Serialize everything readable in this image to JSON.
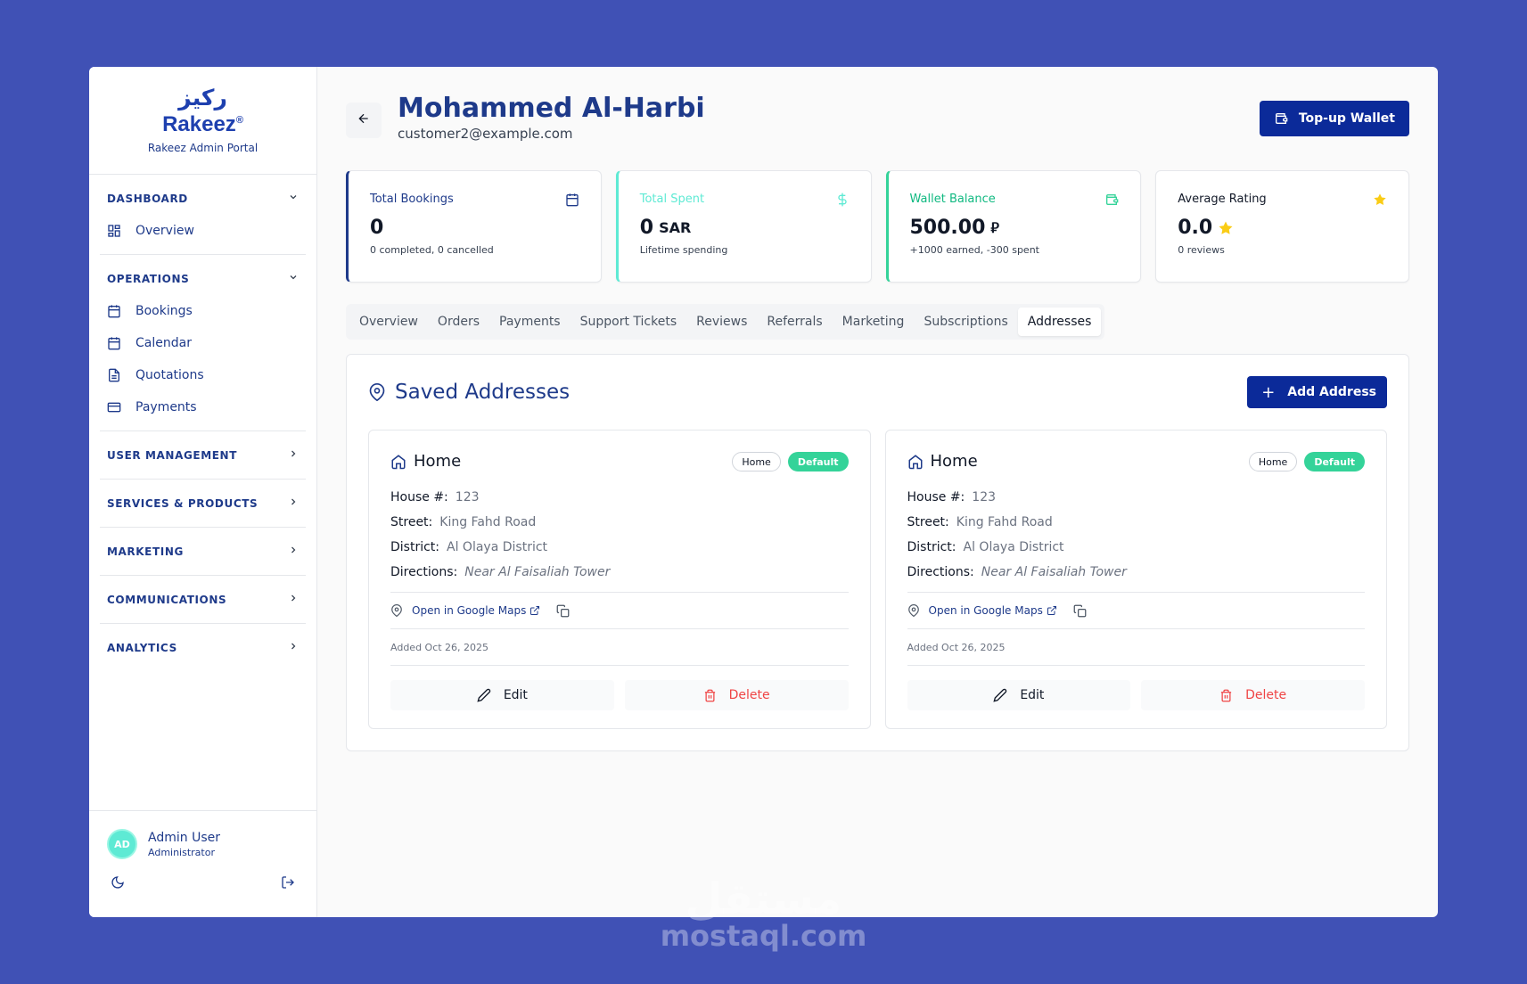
{
  "brand": {
    "arabic": "ركيز",
    "name": "Rakeez",
    "registered": "®",
    "subtitle": "Rakeez Admin Portal"
  },
  "sidebar": {
    "sections": [
      {
        "label": "DASHBOARD",
        "items": [
          "Overview"
        ]
      },
      {
        "label": "OPERATIONS",
        "items": [
          "Bookings",
          "Calendar",
          "Quotations",
          "Payments"
        ]
      },
      {
        "label": "USER MANAGEMENT"
      },
      {
        "label": "SERVICES & PRODUCTS"
      },
      {
        "label": "MARKETING"
      },
      {
        "label": "COMMUNICATIONS"
      },
      {
        "label": "ANALYTICS"
      }
    ],
    "user": {
      "initials": "AD",
      "name": "Admin User",
      "role": "Administrator"
    }
  },
  "header": {
    "title": "Mohammed Al-Harbi",
    "email": "customer2@example.com",
    "topup_label": "Top-up Wallet"
  },
  "stats": [
    {
      "label": "Total Bookings",
      "value": "0",
      "sub": "0 completed, 0 cancelled"
    },
    {
      "label": "Total Spent",
      "value": "0",
      "unit": "SAR",
      "sub": "Lifetime spending"
    },
    {
      "label": "Wallet Balance",
      "value": "500.00",
      "unit": "⃁",
      "sub": "+1000 earned, -300 spent"
    },
    {
      "label": "Average Rating",
      "value": "0.0",
      "sub": "0 reviews"
    }
  ],
  "tabs": [
    "Overview",
    "Orders",
    "Payments",
    "Support Tickets",
    "Reviews",
    "Referrals",
    "Marketing",
    "Subscriptions",
    "Addresses"
  ],
  "active_tab": "Addresses",
  "addresses": {
    "title": "Saved Addresses",
    "add_label": "Add Address",
    "cards": [
      {
        "name": "Home",
        "type_badge": "Home",
        "default_badge": "Default",
        "house_label": "House #:",
        "house": "123",
        "street_label": "Street:",
        "street": "King Fahd Road",
        "district_label": "District:",
        "district": "Al Olaya District",
        "directions_label": "Directions:",
        "directions": "Near Al Faisaliah Tower",
        "maps_label": "Open in Google Maps",
        "added": "Added Oct 26, 2025",
        "edit_label": "Edit",
        "delete_label": "Delete"
      },
      {
        "name": "Home",
        "type_badge": "Home",
        "default_badge": "Default",
        "house_label": "House #:",
        "house": "123",
        "street_label": "Street:",
        "street": "King Fahd Road",
        "district_label": "District:",
        "district": "Al Olaya District",
        "directions_label": "Directions:",
        "directions": "Near Al Faisaliah Tower",
        "maps_label": "Open in Google Maps",
        "added": "Added Oct 26, 2025",
        "edit_label": "Edit",
        "delete_label": "Delete"
      }
    ]
  },
  "watermark": {
    "arabic": "مستقل",
    "latin": "mostaql.com"
  },
  "colors": {
    "background": "#4051b5",
    "primary": "#0b2a99",
    "navy_text": "#1e3a8a",
    "teal": "#5eead4",
    "green": "#34d399",
    "danger": "#ef4444",
    "star": "#facc15"
  },
  "icons": [
    "calendar-icon",
    "dollar-icon",
    "wallet-icon",
    "star-icon",
    "map-pin-icon",
    "home-icon",
    "external-link-icon",
    "copy-icon",
    "pencil-icon",
    "trash-icon",
    "moon-icon",
    "logout-icon",
    "arrow-left-icon",
    "chevron-down-icon",
    "chevron-right-icon"
  ]
}
